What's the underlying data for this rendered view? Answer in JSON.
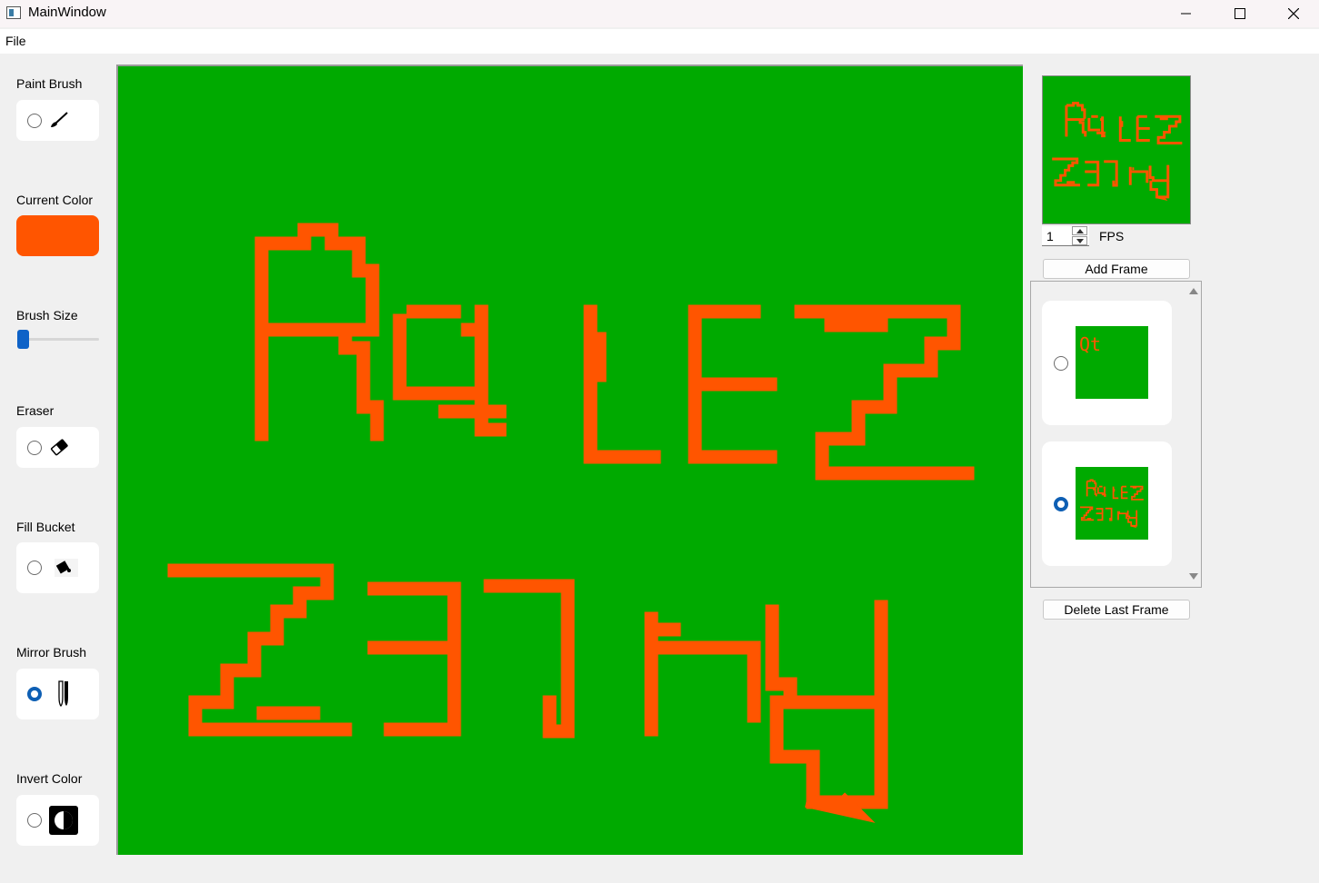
{
  "window": {
    "title": "MainWindow"
  },
  "menu": {
    "items": [
      {
        "label": "File"
      }
    ]
  },
  "tools": {
    "paint_brush": {
      "label": "Paint Brush",
      "icon": "paintbrush-icon",
      "selected": false
    },
    "current_color": {
      "label": "Current Color",
      "value": "#ff5500"
    },
    "brush_size": {
      "label": "Brush Size",
      "level": 0
    },
    "eraser": {
      "label": "Eraser",
      "icon": "eraser-icon",
      "selected": false
    },
    "fill_bucket": {
      "label": "Fill Bucket",
      "icon": "fill-bucket-icon",
      "selected": false
    },
    "mirror_brush": {
      "label": "Mirror Brush",
      "icon": "mirror-icon",
      "selected": true
    },
    "invert_color": {
      "label": "Invert Color",
      "icon": "invert-icon",
      "selected": false
    }
  },
  "canvas": {
    "background": "#00aa00",
    "paint_color": "#ff5500"
  },
  "animation": {
    "fps_value": "1",
    "fps_label": "FPS",
    "add_frame_label": "Add Frame",
    "delete_frame_label": "Delete Last Frame",
    "frames": [
      {
        "thumb_text": "Qt",
        "selected": false
      },
      {
        "thumb_text": "Thumbnail of current drawing",
        "selected": true
      }
    ]
  },
  "colors": {
    "accent": "#0e5fb4",
    "canvas_green": "#00aa00",
    "paint_orange": "#ff5500"
  }
}
